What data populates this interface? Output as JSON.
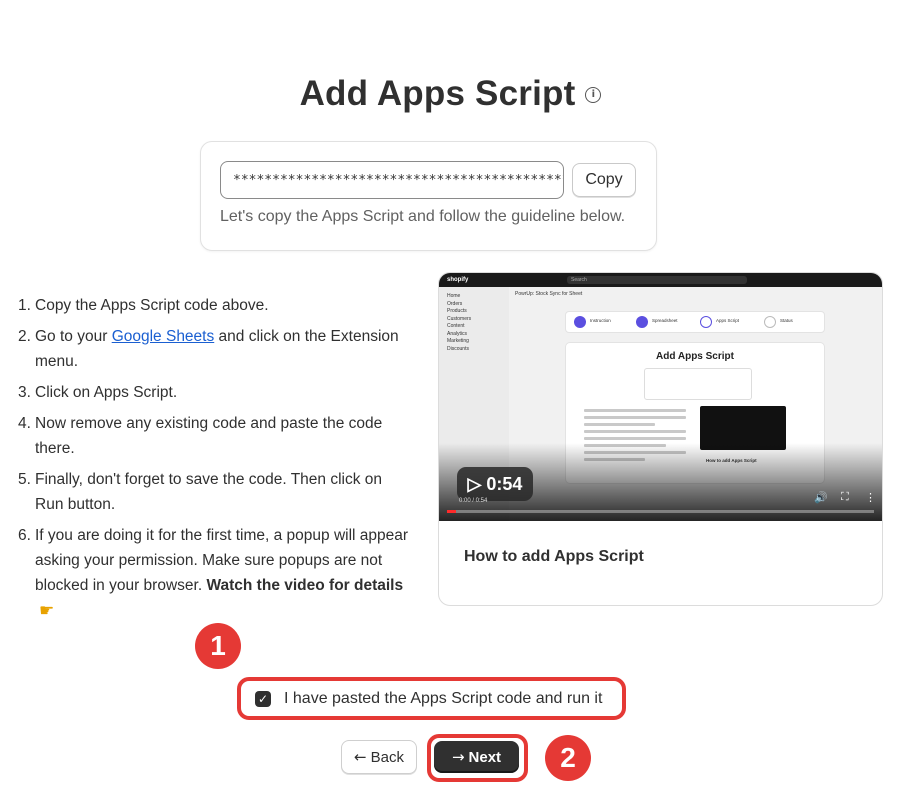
{
  "header": {
    "title": "Add Apps Script",
    "info_icon": "info-icon"
  },
  "script_box": {
    "code_value": "**********************************************",
    "copy_label": "Copy",
    "hint": "Let's copy the Apps Script and follow the guideline below."
  },
  "steps": [
    {
      "num": "1.",
      "text": "Copy the Apps Script code above."
    },
    {
      "num": "2.",
      "pre": "Go to your ",
      "link": "Google Sheets",
      "post": " and click on the Extension menu."
    },
    {
      "num": "3.",
      "text": "Click on Apps Script."
    },
    {
      "num": "4.",
      "text": "Now remove any existing code and paste the code there."
    },
    {
      "num": "5.",
      "text": "Finally, don't forget to save the code. Then click on Run button."
    },
    {
      "num": "6.",
      "pre": "If you are doing it for the first time, a popup will appear asking your permission. Make sure popups are not blocked in your browser. ",
      "bold": "Watch the video for details"
    }
  ],
  "video": {
    "duration": "0:54",
    "caption": "How to add Apps Script",
    "current_time": "0:00 / 0:54",
    "progress_fraction": 0.02,
    "thumbnail": {
      "brand": "shopify",
      "search": "Search",
      "app_title": "PowrUp: Stock Sync for Sheet",
      "nav": [
        "Home",
        "Orders",
        "Products",
        "Customers",
        "Content",
        "Analytics",
        "Marketing",
        "Discounts"
      ],
      "steps": [
        "Instruction",
        "Spreadsheet",
        "Apps Script",
        "Status"
      ],
      "inner_title": "Add Apps Script",
      "inner_video_caption": "How to add Apps Script"
    }
  },
  "badges": {
    "one": "1",
    "two": "2"
  },
  "confirm": {
    "checked": true,
    "check_glyph": "✓",
    "label": "I have pasted the Apps Script code and run it"
  },
  "nav": {
    "back_label": "Back",
    "next_label": "Next",
    "back_arrow": "←",
    "next_arrow": "→"
  },
  "colors": {
    "accent_red": "#e53935",
    "primary_dark": "#303030",
    "link_blue": "#1a5fd1"
  }
}
